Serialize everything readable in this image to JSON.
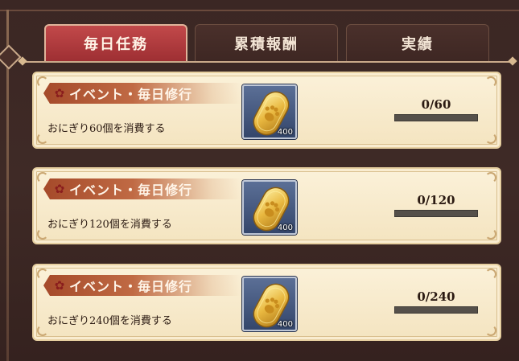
{
  "tabs": [
    {
      "label": "毎日任務",
      "active": true
    },
    {
      "label": "累積報酬",
      "active": false
    },
    {
      "label": "実績",
      "active": false
    }
  ],
  "tasks": [
    {
      "category": "イベント・毎日修行",
      "description": "おにぎり60個を消費する",
      "reward_icon": "paw-coin-icon",
      "reward_count": "400",
      "progress_text": "0/60",
      "progress": 0
    },
    {
      "category": "イベント・毎日修行",
      "description": "おにぎり120個を消費する",
      "reward_icon": "paw-coin-icon",
      "reward_count": "400",
      "progress_text": "0/120",
      "progress": 0
    },
    {
      "category": "イベント・毎日修行",
      "description": "おにぎり240個を消費する",
      "reward_icon": "paw-coin-icon",
      "reward_count": "400",
      "progress_text": "0/240",
      "progress": 0
    }
  ],
  "colors": {
    "active_tab": "#b13c3f",
    "inactive_tab": "#432c27",
    "card_bg": "#f7e9c9",
    "ribbon": "#b3593a",
    "progress_track": "#55504a"
  }
}
